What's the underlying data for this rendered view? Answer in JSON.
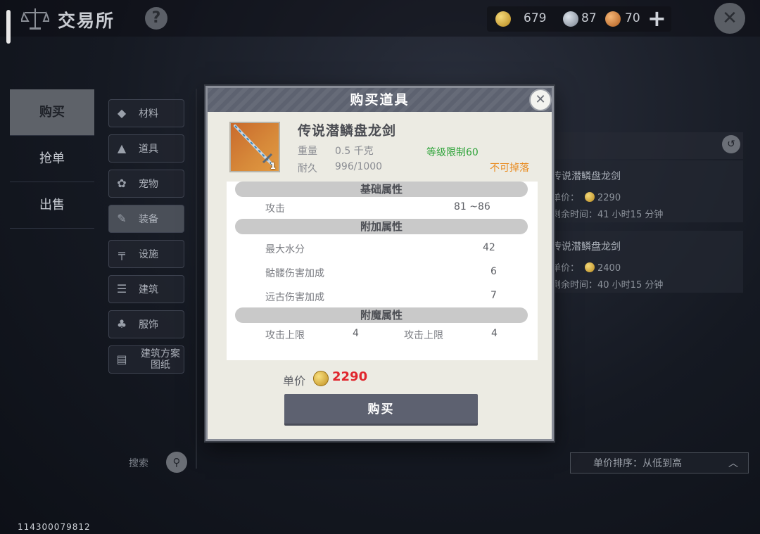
{
  "header": {
    "title": "交易所",
    "help": "?",
    "currency": {
      "gold": "679",
      "silver": "87",
      "bronze": "70"
    },
    "add": "+"
  },
  "left_tabs": [
    {
      "label": "购买",
      "active": true
    },
    {
      "label": "抢单",
      "active": false
    },
    {
      "label": "出售",
      "active": false
    }
  ],
  "categories": [
    {
      "label": "材料",
      "icon": "ore-icon"
    },
    {
      "label": "道具",
      "icon": "potion-icon"
    },
    {
      "label": "宠物",
      "icon": "paw-icon"
    },
    {
      "label": "装备",
      "icon": "equipment-icon"
    },
    {
      "label": "设施",
      "icon": "facility-icon"
    },
    {
      "label": "建筑",
      "icon": "brick-icon"
    },
    {
      "label": "服饰",
      "icon": "clothes-icon"
    },
    {
      "label": "建筑方案\n图纸",
      "icon": "blueprint-icon"
    }
  ],
  "search": {
    "label": "搜索"
  },
  "listings": [
    {
      "name": "传说潜鳞盘龙剑",
      "price_label": "单价：",
      "price": "2290",
      "time": "剩余时间：41 小时15 分钟"
    },
    {
      "name": "传说潜鳞盘龙剑",
      "price_label": "单价：",
      "price": "2400",
      "time": "剩余时间：40 小时15 分钟"
    }
  ],
  "sort": {
    "label": "单价排序：从低到高"
  },
  "uid": "114300079812",
  "modal": {
    "title": "购买道具",
    "item": {
      "name": "传说潜鳞盘龙剑",
      "count": "1",
      "weight_label": "重量",
      "weight": "0.5 千克",
      "durability_label": "耐久",
      "durability": "996/1000",
      "level_req": "等级限制60",
      "no_drop": "不可掉落"
    },
    "sections": {
      "basic": "基础属性",
      "extra": "附加属性",
      "enchant": "附魔属性"
    },
    "basic_stats": [
      {
        "label": "攻击",
        "value": "81 ~86"
      }
    ],
    "extra_stats": [
      {
        "label": "最大水分",
        "value": "42"
      },
      {
        "label": "骷髅伤害加成",
        "value": "6"
      },
      {
        "label": "远古伤害加成",
        "value": "7"
      }
    ],
    "enchant_stats": [
      {
        "label": "攻击上限",
        "value": "4"
      },
      {
        "label": "攻击上限",
        "value": "4"
      }
    ],
    "price_label": "单价",
    "price": "2290",
    "buy_label": "购买"
  },
  "colors": {
    "price": "#e0262d",
    "level_req": "#2fa33a",
    "no_drop": "#e98c21",
    "header_bar": "#5d6270"
  }
}
